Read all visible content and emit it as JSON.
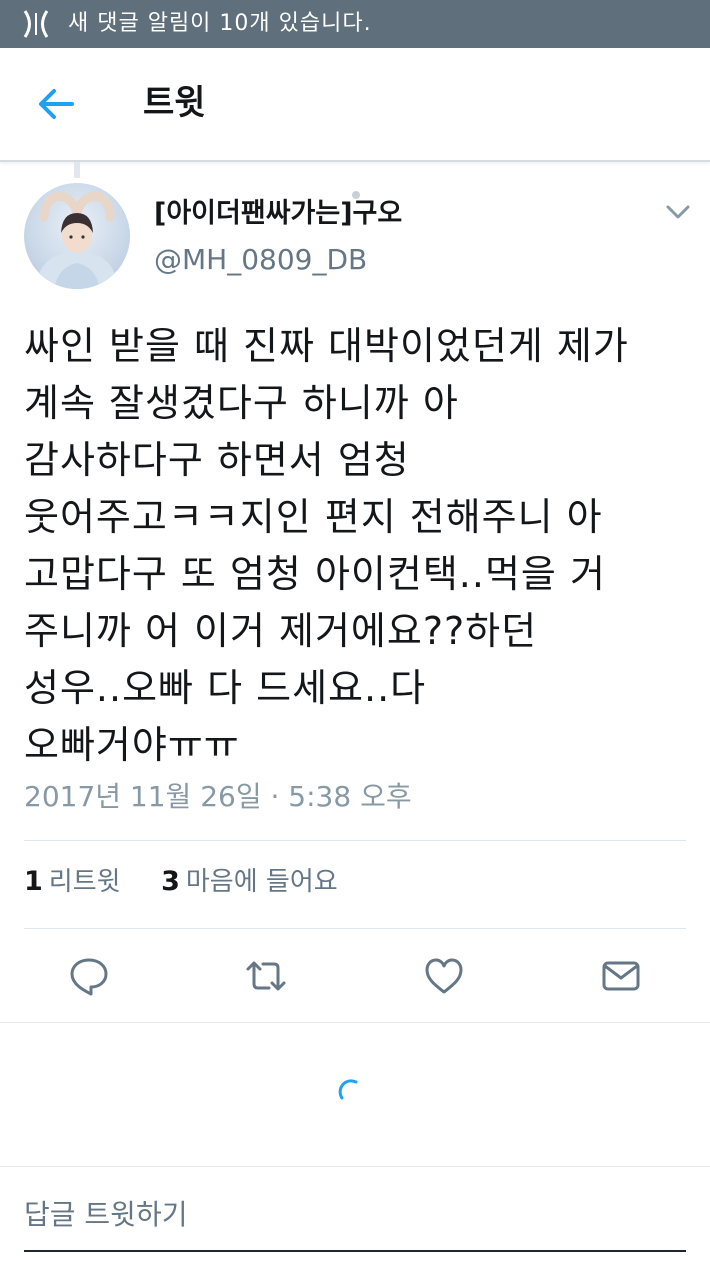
{
  "status_bar": {
    "notification_text": "새 댓글 알림이 10개 있습니다.",
    "background_color": "#5f6f7b"
  },
  "header": {
    "back_icon": "arrow-left-icon",
    "title": "트윗"
  },
  "tweet": {
    "display_name": "[아이더팬싸가는]구오",
    "handle": "@MH_0809_DB",
    "menu_icon": "chevron-down-icon",
    "text_lines": [
      "싸인 받을 때 진짜 대박이었던게 제가",
      "계속 잘생겼다구 하니까 아",
      "감사하다구 하면서 엄청",
      "웃어주고ㅋㅋ지인 편지 전해주니 아",
      "고맙다구 또 엄청 아이컨택..먹을 거",
      "주니까 어 이거 제거에요??하던",
      "성우..오빠 다 드세요..다",
      "오빠거야ㅠㅠ"
    ],
    "timestamp": "2017년 11월 26일 · 5:38 오후",
    "stats": {
      "retweet_count": "1",
      "retweet_label": "리트윗",
      "like_count": "3",
      "like_label": "마음에 들어요"
    }
  },
  "actions": [
    {
      "icon": "reply-icon"
    },
    {
      "icon": "retweet-icon"
    },
    {
      "icon": "heart-icon"
    },
    {
      "icon": "mail-icon"
    }
  ],
  "reply_box": {
    "placeholder": "답글 트윗하기"
  },
  "colors": {
    "accent": "#1da1f2",
    "text_primary": "#14171a",
    "text_secondary": "#657786",
    "divider": "#e1e8ed"
  }
}
